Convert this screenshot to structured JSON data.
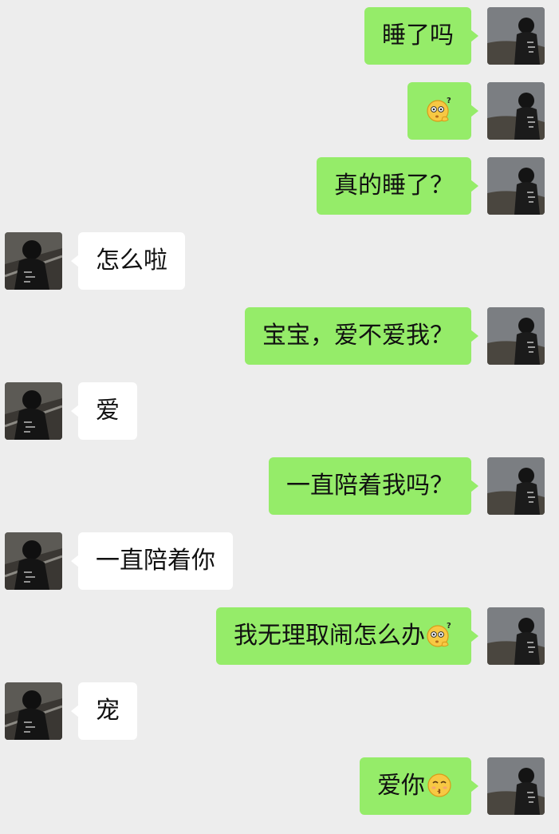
{
  "messages": [
    {
      "side": "me",
      "text": "睡了吗",
      "emoji": null
    },
    {
      "side": "me",
      "text": "",
      "emoji": "thinking-face-icon"
    },
    {
      "side": "me",
      "text": "真的睡了？",
      "emoji": null
    },
    {
      "side": "them",
      "text": "怎么啦",
      "emoji": null
    },
    {
      "side": "me",
      "text": "宝宝，爱不爱我？",
      "emoji": null
    },
    {
      "side": "them",
      "text": "爱",
      "emoji": null
    },
    {
      "side": "me",
      "text": "一直陪着我吗？",
      "emoji": null
    },
    {
      "side": "them",
      "text": "一直陪着你",
      "emoji": null
    },
    {
      "side": "me",
      "text": "我无理取闹怎么办",
      "emoji": "thinking-face-icon"
    },
    {
      "side": "them",
      "text": "宠",
      "emoji": null
    },
    {
      "side": "me",
      "text": "爱你",
      "emoji": "kissing-face-icon"
    }
  ],
  "colors": {
    "background": "#ededed",
    "my_bubble": "#95ec69",
    "their_bubble": "#ffffff"
  }
}
